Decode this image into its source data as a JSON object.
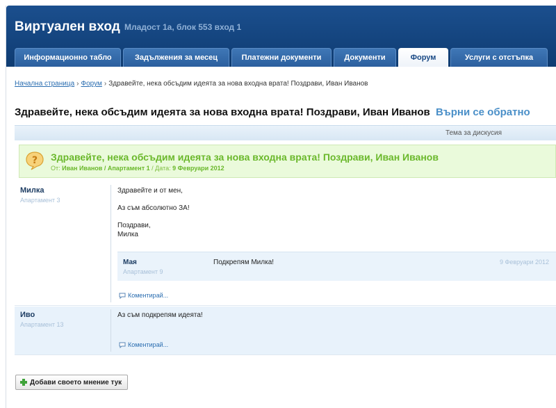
{
  "header": {
    "title": "Виртуален вход",
    "subtitle": "Младост 1а, блок 553 вход 1"
  },
  "tabs": [
    {
      "label": "Информационно табло",
      "active": false
    },
    {
      "label": "Задължения за месец",
      "active": false
    },
    {
      "label": "Платежни документи",
      "active": false
    },
    {
      "label": "Документи",
      "active": false
    },
    {
      "label": "Форум",
      "active": true
    },
    {
      "label": "Услуги с отстъпка",
      "active": false
    }
  ],
  "breadcrumb": {
    "home": "Начална страница",
    "forum": "Форум",
    "current": "Здравейте, нека обсъдим идеята за нова входна врата! Поздрави, Иван Иванов"
  },
  "page": {
    "title": "Здравейте, нека обсъдим идеята за нова входна врата! Поздрави, Иван Иванов",
    "back_link": "Върни се обратно"
  },
  "thread_header": {
    "label": "Тема за дискусия"
  },
  "topic": {
    "title": "Здравейте, нека обсъдим идеята за нова входна врата! Поздрави, Иван Иванов",
    "from_label": "От:",
    "author": "Иван Иванов",
    "apartment": "Апартамент 1",
    "date_label": "Дата:",
    "date": "9 Февруари 2012"
  },
  "posts": [
    {
      "author": "Милка",
      "apartment": "Апартамент 3",
      "lines": [
        "Здравейте и от мен,",
        "Аз съм абсолютно ЗА!",
        "Поздрави,",
        "Милка"
      ],
      "reply": {
        "author": "Мая",
        "apartment": "Апартамент 9",
        "text": "Подкрепям Милка!",
        "date": "9 Февруари 2012"
      },
      "comment_link": "Коментирай..."
    },
    {
      "author": "Иво",
      "apartment": "Апартамент 13",
      "lines": [
        "Аз съм подкрепям идеята!"
      ],
      "comment_link": "Коментирай..."
    }
  ],
  "add_button": {
    "label": "Добави своето мнение тук"
  },
  "colors": {
    "header_bg": "#1b4f8e",
    "topic_green": "#6ab82b",
    "link_blue": "#2a6db0"
  }
}
